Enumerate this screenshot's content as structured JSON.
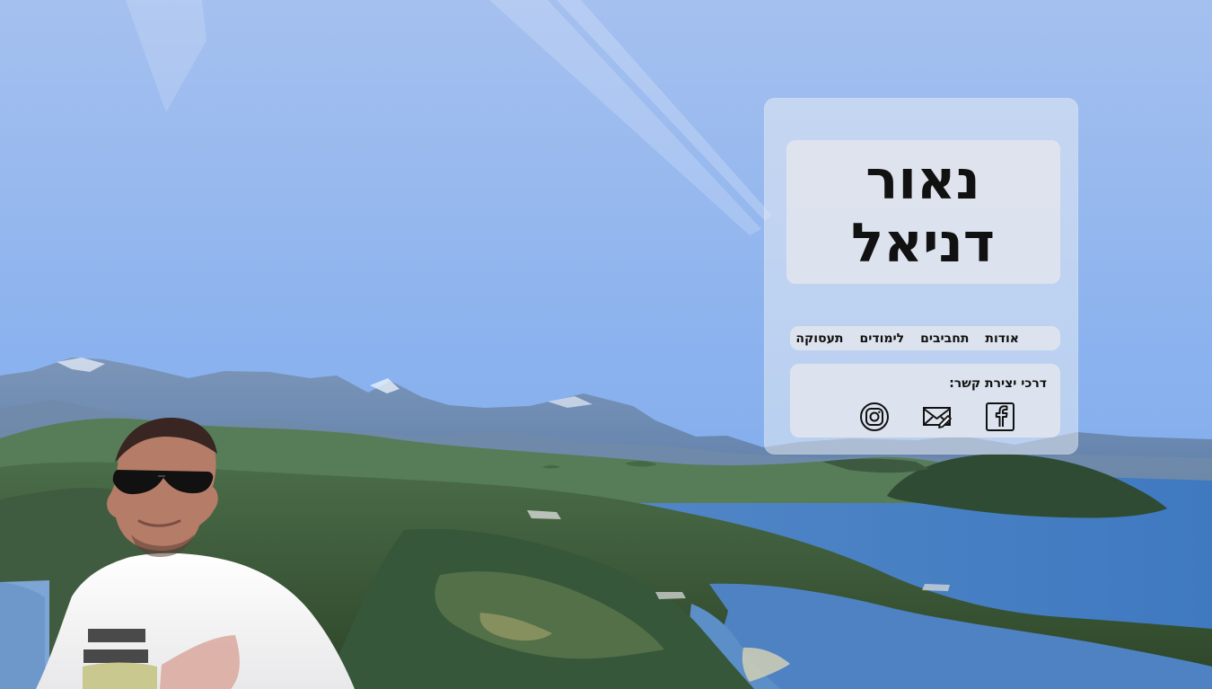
{
  "profile": {
    "name_line_1": "נאור",
    "name_line_2": "דניאל"
  },
  "navigation": {
    "items": [
      {
        "label": "אודות"
      },
      {
        "label": "תחביבים"
      },
      {
        "label": "לימודים"
      },
      {
        "label": "תעסוקה"
      }
    ]
  },
  "contact": {
    "label": "דרכי יצירת קשר:",
    "icons": [
      {
        "name": "facebook-icon"
      },
      {
        "name": "mail-icon"
      },
      {
        "name": "instagram-icon"
      }
    ]
  },
  "colors": {
    "sky_top": "#9eb8ea",
    "sky_bottom": "#4e84d2",
    "lake": "#4f84c4",
    "forest": "#355338",
    "card": "#eaedf4",
    "text": "#111111"
  }
}
